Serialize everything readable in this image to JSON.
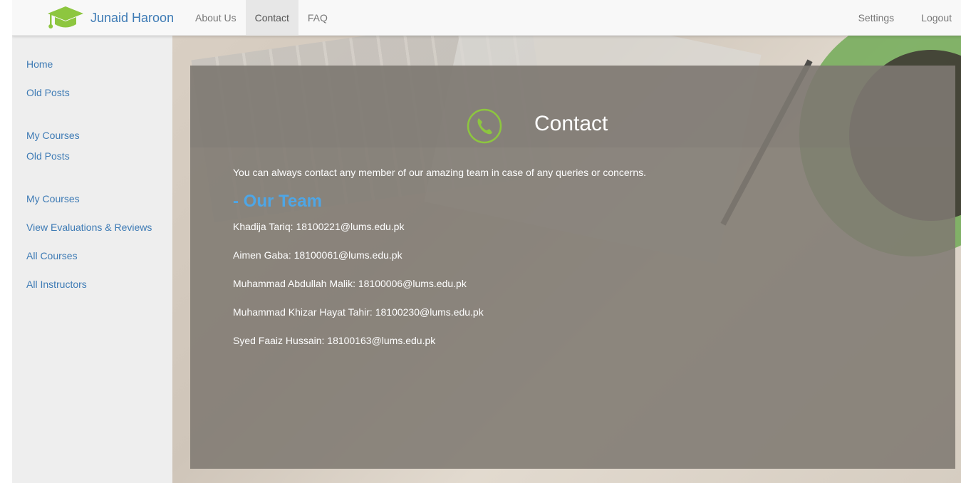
{
  "brand": {
    "name": "Junaid Haroon",
    "icon": "graduation-cap-icon",
    "color": "#8dc63f"
  },
  "nav": {
    "left": [
      {
        "label": "About Us",
        "active": false
      },
      {
        "label": "Contact",
        "active": true
      },
      {
        "label": "FAQ",
        "active": false
      }
    ],
    "right": [
      {
        "label": "Settings"
      },
      {
        "label": "Logout"
      }
    ]
  },
  "sidebar": {
    "items": [
      {
        "label": "Home"
      },
      {
        "label": "Old Posts"
      },
      {
        "label": "My Courses"
      },
      {
        "label": "Old Posts"
      },
      {
        "label": "My Courses"
      },
      {
        "label": "View Evaluations & Reviews"
      },
      {
        "label": "All Courses"
      },
      {
        "label": "All Instructors"
      }
    ]
  },
  "contact": {
    "icon": "phone-icon",
    "title": "Contact",
    "intro": "You can always contact any member of our amazing team in case of any queries or concerns.",
    "team_heading": "- Our Team",
    "members": [
      "Khadija Tariq: 18100221@lums.edu.pk",
      "Aimen Gaba: 18100061@lums.edu.pk",
      "Muhammad Abdullah Malik: 18100006@lums.edu.pk",
      "Muhammad Khizar Hayat Tahir: 18100230@lums.edu.pk",
      "Syed Faaiz Hussain: 18100163@lums.edu.pk"
    ]
  },
  "colors": {
    "link": "#3e7bb5",
    "accent": "#8dc63f",
    "heading": "#4ea6e6"
  }
}
